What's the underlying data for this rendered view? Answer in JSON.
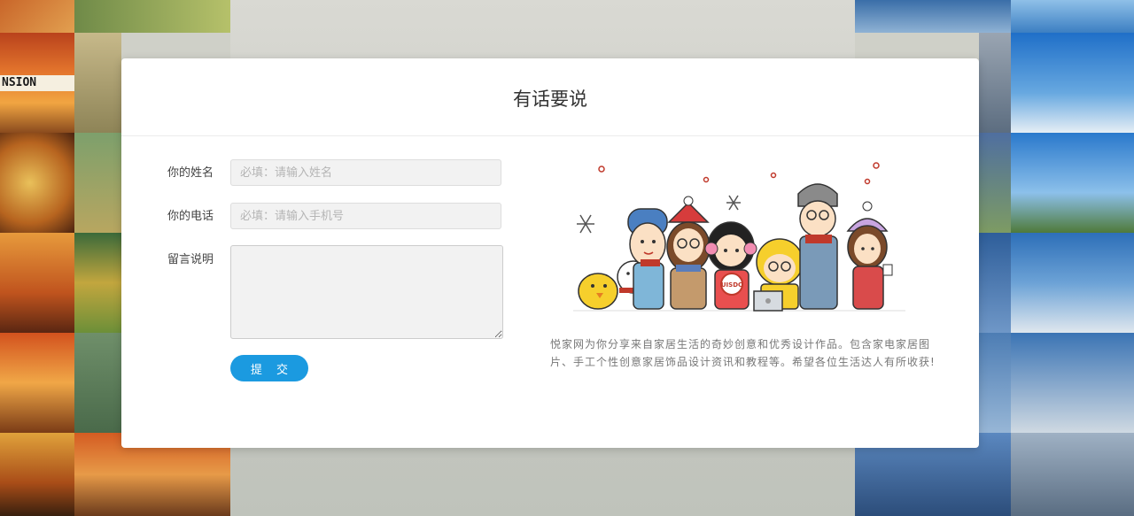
{
  "dialog": {
    "title": "有话要说",
    "name_label": "你的姓名",
    "name_placeholder": "必填：请输入姓名",
    "phone_label": "你的电话",
    "phone_placeholder": "必填：请输入手机号",
    "message_label": "留言说明",
    "submit_label": "提 交",
    "description": "悦家网为你分享来自家居生活的奇妙创意和优秀设计作品。包含家电家居图片、手工个性创意家居饰品设计资讯和教程等。希望各位生活达人有所收获!"
  },
  "background_left_sign_text": "NSION",
  "illustration": {
    "badge_text": "UISDC"
  },
  "colors": {
    "accent": "#1b9ae0",
    "title": "#333333",
    "description": "#777777"
  }
}
